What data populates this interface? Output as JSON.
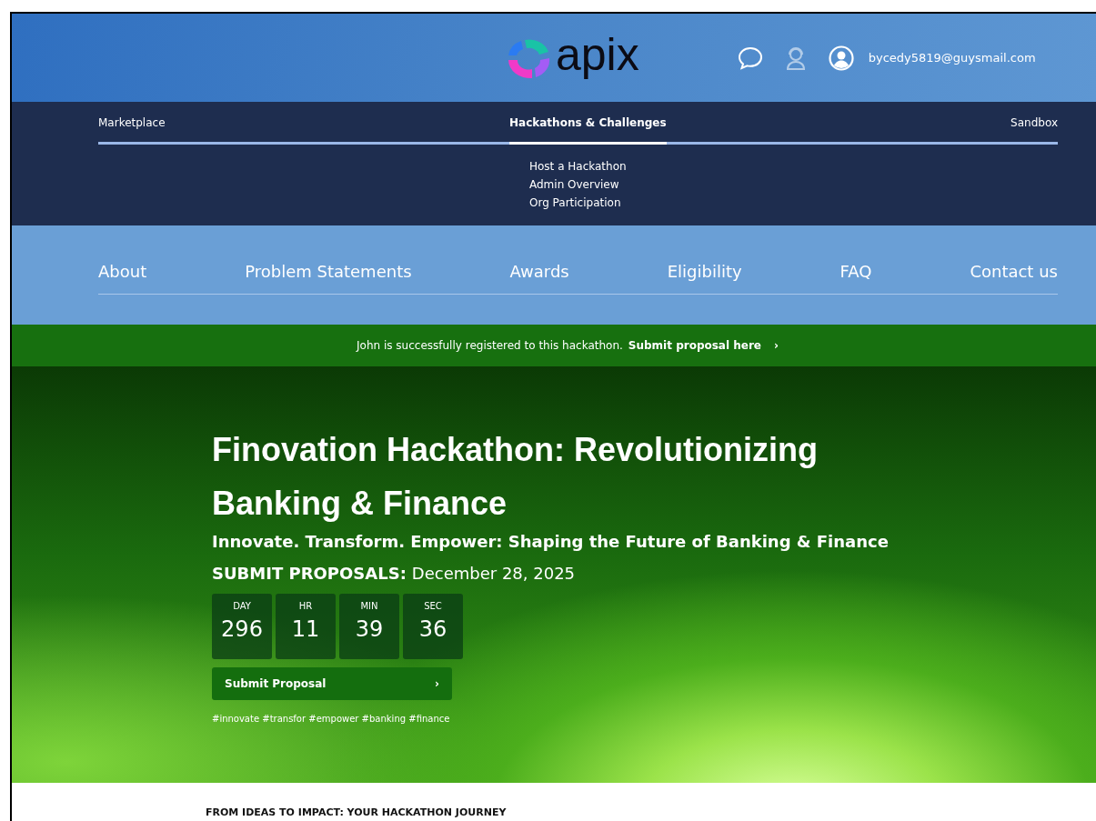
{
  "header": {
    "logo_text": "apix",
    "email": "bycedy5819@guysmail.com"
  },
  "top_nav": {
    "items": [
      {
        "label": "Marketplace",
        "selected": false
      },
      {
        "label": "Hackathons & Challenges",
        "selected": true,
        "submenu": [
          "Host a Hackathon",
          "Admin Overview",
          "Org Participation"
        ]
      },
      {
        "label": "Sandbox",
        "selected": false
      }
    ]
  },
  "section_nav": {
    "items": [
      "About",
      "Problem Statements",
      "Awards",
      "Eligibility",
      "FAQ",
      "Contact us"
    ]
  },
  "notice": {
    "text": "John is successfully registered to this hackathon.",
    "link": "Submit proposal here",
    "chevron": "›"
  },
  "hero": {
    "title": "Finovation Hackathon: Revolutionizing Banking & Finance",
    "subtitle": "Innovate. Transform. Empower: Shaping the Future of Banking & Finance",
    "deadline_label": "SUBMIT PROPOSALS:",
    "deadline_date": "December 28, 2025",
    "countdown": [
      {
        "unit": "DAY",
        "value": "296"
      },
      {
        "unit": "HR",
        "value": "11"
      },
      {
        "unit": "MIN",
        "value": "39"
      },
      {
        "unit": "SEC",
        "value": "36"
      }
    ],
    "button": {
      "label": "Submit Proposal",
      "chevron": "›"
    },
    "hashtags": "#innovate #transfor #empower #banking #finance"
  },
  "section_heading": "FROM IDEAS TO IMPACT: YOUR HACKATHON JOURNEY"
}
